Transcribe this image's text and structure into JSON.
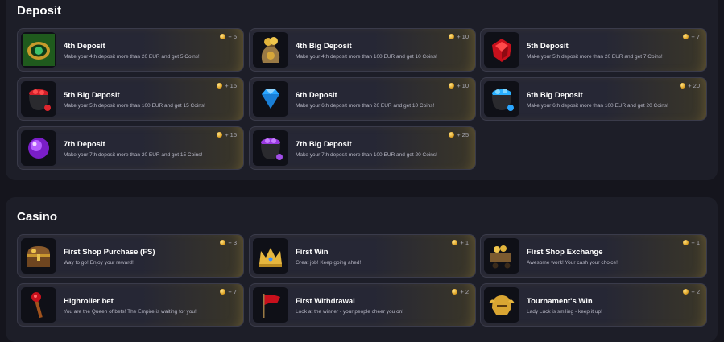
{
  "sections": [
    {
      "title": "Deposit",
      "cards": [
        {
          "title": "4th Deposit",
          "desc": "Make your 4th deposit more than 20 EUR and get 5 Coins!",
          "reward": "+ 5",
          "icon": "green-ring-icon"
        },
        {
          "title": "4th Big Deposit",
          "desc": "Make your 4th deposit more than 100 EUR and get 10 Coins!",
          "reward": "+ 10",
          "icon": "coin-bag-icon"
        },
        {
          "title": "5th Deposit",
          "desc": "Make your 5th deposit more than 20 EUR and get 7 Coins!",
          "reward": "+ 7",
          "icon": "ruby-gem-icon"
        },
        {
          "title": "5th Big Deposit",
          "desc": "Make your 5th deposit more than 100 EUR and get 15 Coins!",
          "reward": "+ 15",
          "icon": "ruby-cauldron-icon"
        },
        {
          "title": "6th Deposit",
          "desc": "Make your 6th deposit more than 20 EUR and get 10 Coins!",
          "reward": "+ 10",
          "icon": "diamond-icon"
        },
        {
          "title": "6th Big Deposit",
          "desc": "Make your 6th deposit more than 100 EUR and get 20 Coins!",
          "reward": "+ 20",
          "icon": "diamond-cauldron-icon"
        },
        {
          "title": "7th Deposit",
          "desc": "Make your 7th deposit more than 20 EUR and get 15 Coins!",
          "reward": "+ 15",
          "icon": "purple-orb-icon"
        },
        {
          "title": "7th Big Deposit",
          "desc": "Make your 7th deposit more than 100 EUR and get 20 Coins!",
          "reward": "+ 25",
          "icon": "amethyst-cauldron-icon"
        }
      ]
    },
    {
      "title": "Casino",
      "cards": [
        {
          "title": "First Shop Purchase (FS)",
          "desc": "Way to go! Enjoy your reward!",
          "reward": "+ 3",
          "icon": "treasure-chest-icon"
        },
        {
          "title": "First Win",
          "desc": "Great job! Keep going ahed!",
          "reward": "+ 1",
          "icon": "crown-icon"
        },
        {
          "title": "First Shop Exchange",
          "desc": "Awesome work! Your cash your choice!",
          "reward": "+ 1",
          "icon": "gold-cart-icon"
        },
        {
          "title": "Highroller bet",
          "desc": "You are the Queen of bets! The Empire is waiting for you!",
          "reward": "+ 7",
          "icon": "scepter-icon"
        },
        {
          "title": "First Withdrawal",
          "desc": "Look at the winner - your people cheer you on!",
          "reward": "+ 2",
          "icon": "red-flag-icon"
        },
        {
          "title": "Tournament's Win",
          "desc": "Lady Luck is smiling - keep it up!",
          "reward": "+ 2",
          "icon": "golden-helmet-icon"
        }
      ]
    }
  ]
}
